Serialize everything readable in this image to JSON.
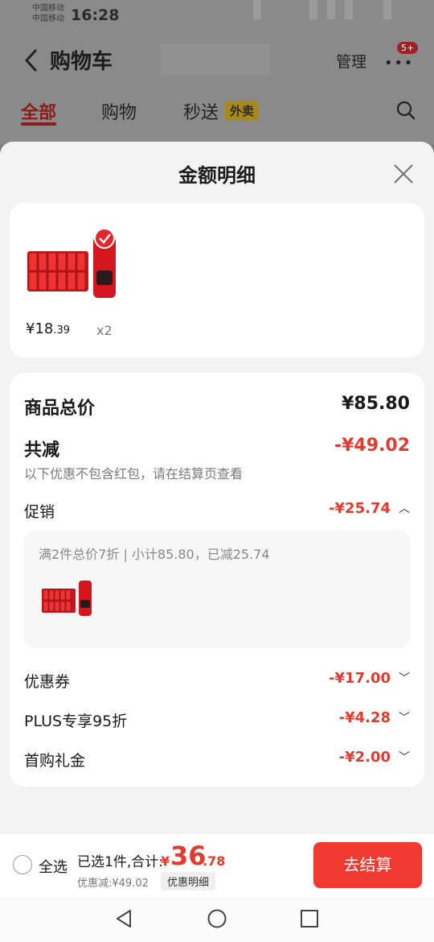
{
  "status_bar": {
    "carrier1": "中国移动",
    "carrier2": "中国移动",
    "time": "16:28"
  },
  "header": {
    "title": "购物车",
    "manage_label": "管理",
    "more_icon": "more-dots-icon",
    "badge": "5+"
  },
  "tabs": [
    {
      "label": "全部",
      "active": true
    },
    {
      "label": "购物",
      "active": false
    },
    {
      "label": "秒送",
      "active": false,
      "tag": "外卖"
    }
  ],
  "sheet": {
    "title": "金额明细",
    "product": {
      "price_main": "¥18",
      "price_dec": ".39",
      "qty": "x2"
    },
    "rows": {
      "goods_total": {
        "label": "商品总价",
        "amount": "¥85.80"
      },
      "total_reduce": {
        "label": "共减",
        "amount": "-¥49.02",
        "note": "以下优惠不包含红包，请在结算页查看"
      },
      "promotion": {
        "label": "促销",
        "amount": "-¥25.74",
        "detail": "满2件总价7折 | 小计85.80，已减25.74"
      },
      "coupon": {
        "label": "优惠券",
        "amount": "-¥17.00"
      },
      "plus": {
        "label": "PLUS专享95折",
        "amount": "-¥4.28"
      },
      "first_gift": {
        "label": "首购礼金",
        "amount": "-¥2.00"
      }
    }
  },
  "bottom": {
    "select_all": "全选",
    "summary": "已选1件,合计:",
    "total_symbol": "¥",
    "total_int": "36",
    "total_dec": ".78",
    "discount": "优惠减:¥49.02",
    "detail_chip": "优惠明细",
    "checkout": "去结算"
  },
  "colors": {
    "accent": "#e23b2f",
    "button": "#f03a31"
  }
}
